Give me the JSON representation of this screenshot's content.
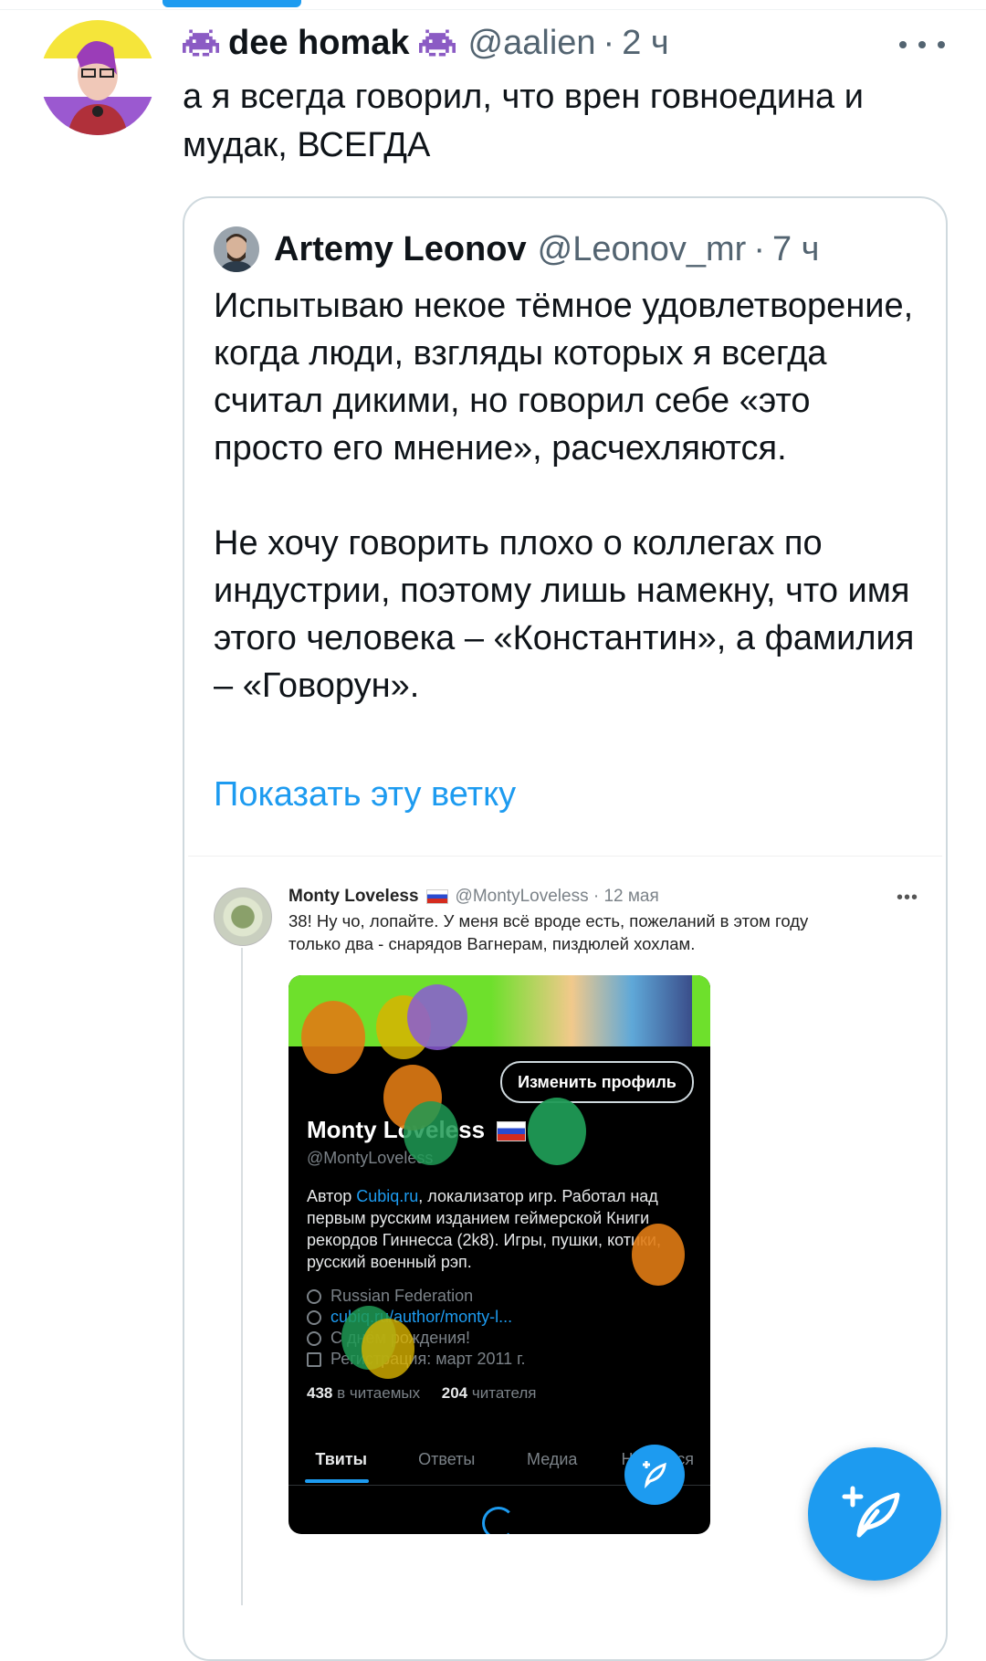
{
  "tweet": {
    "display_name": "dee homak",
    "handle": "@aalien",
    "dot": "·",
    "time": "2 ч",
    "text": "а я всегда говорил, что врен говноедина и мудак, ВСЕГДА"
  },
  "quote": {
    "display_name": "Artemy Leonov",
    "handle": "@Leonov_mr",
    "dot": "·",
    "time": "7 ч",
    "paragraph1": "Испытываю некое тёмное удовлетворение, когда люди, взгляды которых я всегда считал дикими, но говорил себе «это просто его мнение», расчехляются.",
    "paragraph2": "Не хочу говорить плохо о коллегах по индустрии, поэтому лишь намекну, что имя этого человека – «Константин»,  а фамилия – «Говорун».",
    "show_thread": "Показать эту ветку"
  },
  "embedded": {
    "name": "Monty Loveless",
    "meta": "@MontyLoveless · 12 мая",
    "more": "•••",
    "text": "38! Ну чо, лопайте. У меня всё вроде есть, пожеланий в этом году только два - снарядов Вагнерам, пиздюлей хохлам.",
    "profile": {
      "edit_button": "Изменить профиль",
      "name": "Monty Loveless",
      "handle": "@MontyLoveless",
      "bio_prefix": "Автор ",
      "bio_link": "Cubiq.ru",
      "bio_rest": ", локализатор игр. Работал над первым русским изданием геймерской Книги рекордов Гиннесса (2k8). Игры, пушки, котики, русский военный рэп.",
      "location": "Russian Federation",
      "website": "cubiq.ru/author/monty-l...",
      "birthday": "С днём рождения!",
      "joined": "Регистрация: март 2011 г.",
      "following_count": "438",
      "following_label": "в читаемых",
      "followers_count": "204",
      "followers_label": "читателя",
      "tabs": [
        "Твиты",
        "Ответы",
        "Медиа",
        "Нравится"
      ]
    }
  },
  "fab": {
    "icon": "compose-tweet-icon"
  },
  "colors": {
    "accent": "#1d9bf0",
    "text": "#0f1419",
    "muted": "#536471",
    "border": "#cfd9de"
  }
}
